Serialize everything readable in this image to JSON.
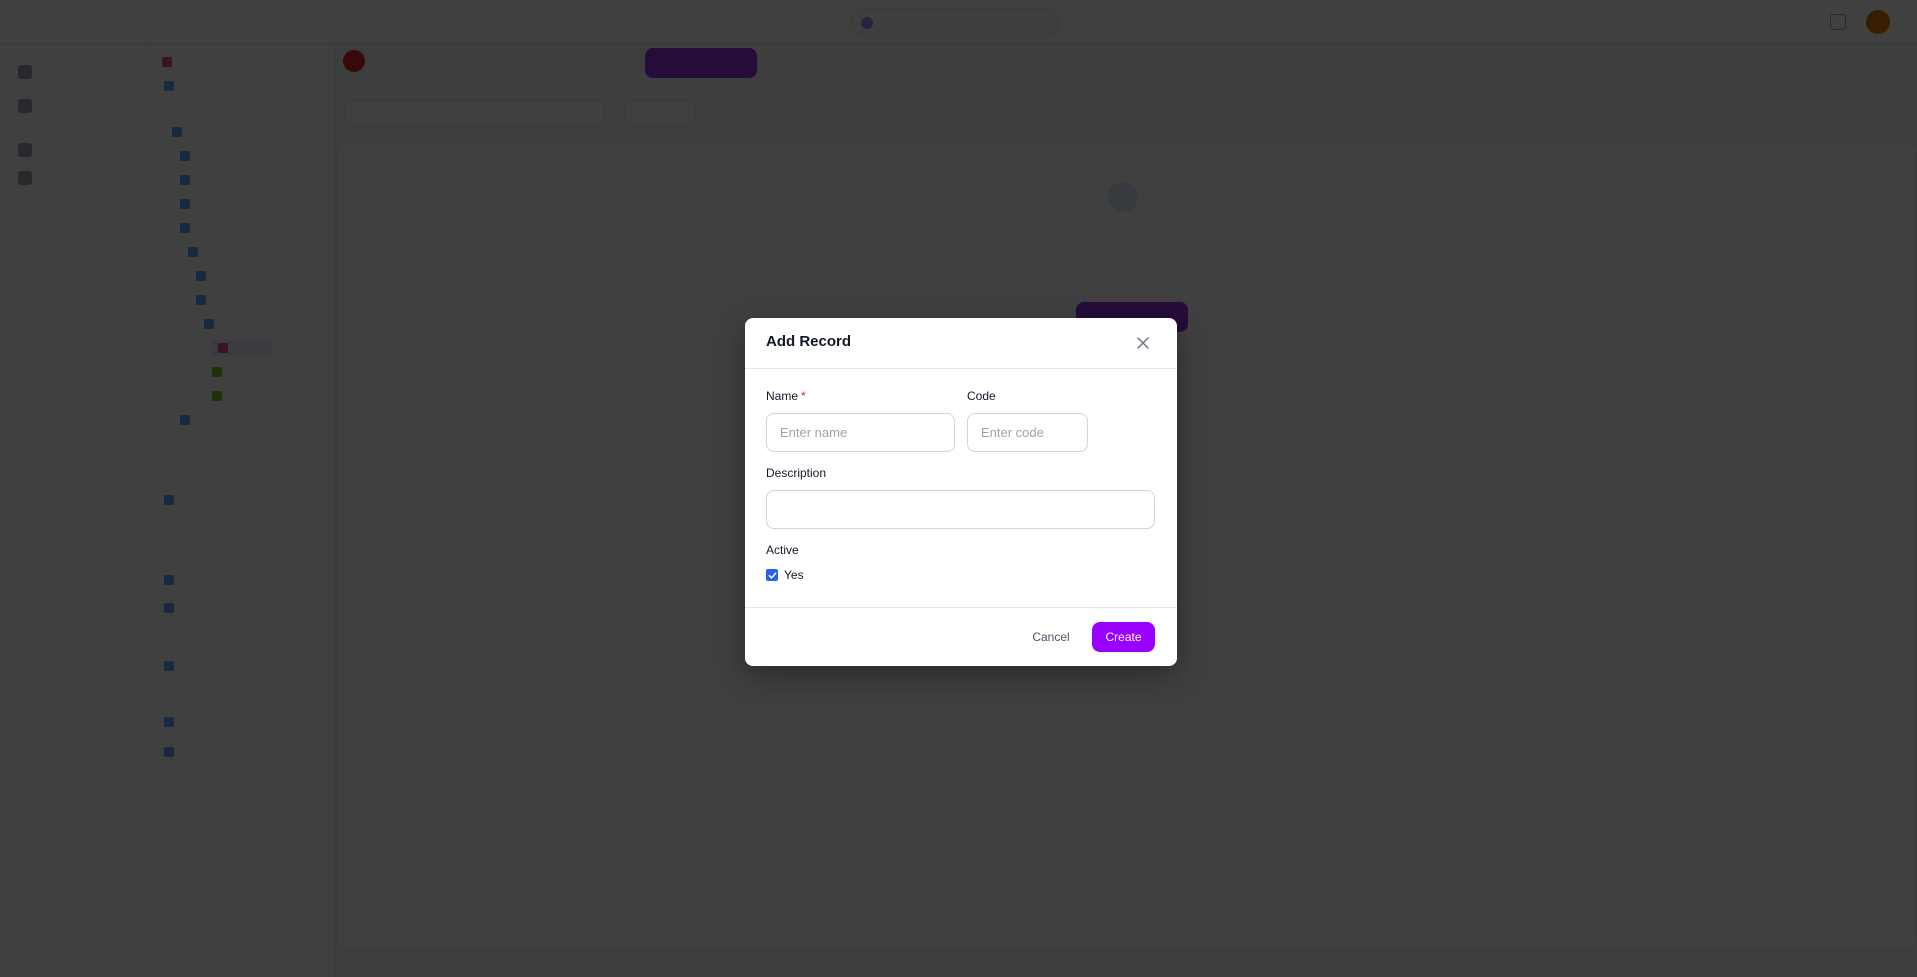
{
  "modal": {
    "title": "Add Record",
    "fields": {
      "name": {
        "label": "Name",
        "required_marker": "*",
        "placeholder": "Enter name",
        "value": ""
      },
      "code": {
        "label": "Code",
        "placeholder": "Enter code",
        "value": ""
      },
      "description": {
        "label": "Description",
        "placeholder": "",
        "value": ""
      }
    },
    "active": {
      "label": "Active",
      "option_label": "Yes",
      "checked": true
    },
    "buttons": {
      "cancel": "Cancel",
      "create": "Create"
    }
  },
  "colors": {
    "accent": "#9900ff",
    "checkbox": "#2563eb",
    "required": "#dc2626"
  }
}
